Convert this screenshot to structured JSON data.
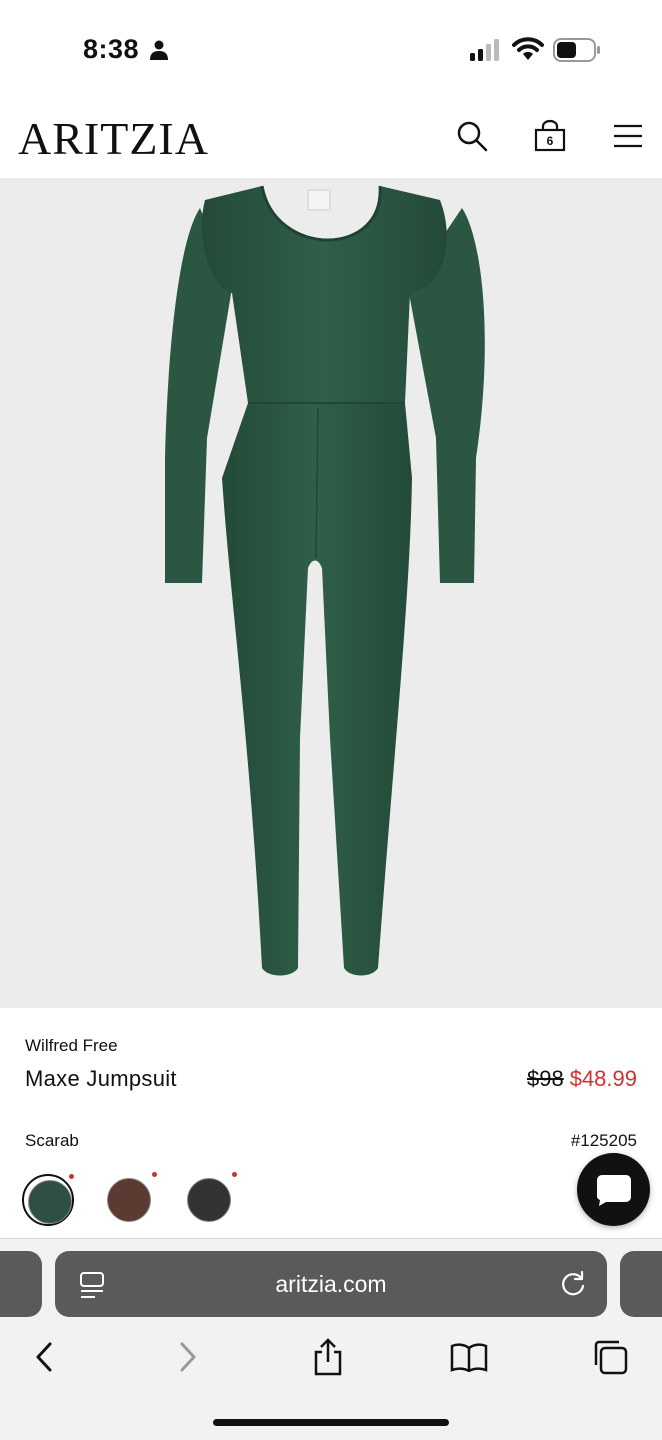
{
  "status_bar": {
    "time": "8:38"
  },
  "header": {
    "logo": "ARITZIA",
    "bag_count": "6"
  },
  "product": {
    "brand": "Wilfred Free",
    "name": "Maxe Jumpsuit",
    "original_price": "$98",
    "sale_price": "$48.99",
    "color_name": "Scarab",
    "sku": "#125205",
    "swatches": [
      {
        "color": "#2f4f45",
        "selected": true
      },
      {
        "color": "#5b3b31",
        "selected": false
      },
      {
        "color": "#333333",
        "selected": false
      }
    ],
    "garment_color": "#2d5a45"
  },
  "browser": {
    "url": "aritzia.com"
  },
  "colors": {
    "sale": "#d0312d",
    "image_bg": "#ececec",
    "address_bar": "#5a5a5c"
  }
}
